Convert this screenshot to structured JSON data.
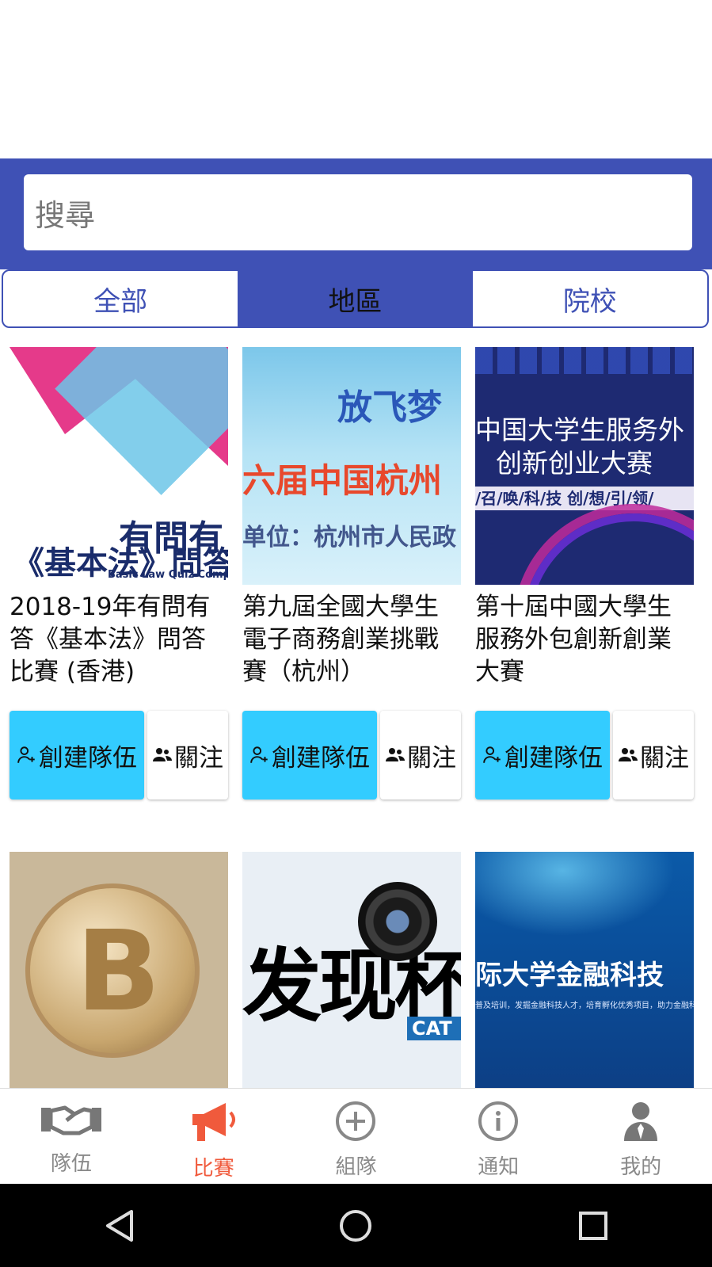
{
  "search": {
    "placeholder": "搜尋"
  },
  "tabs": [
    {
      "label": "全部",
      "active": false
    },
    {
      "label": "地區",
      "active": true
    },
    {
      "label": "院校",
      "active": false
    }
  ],
  "cards": [
    {
      "title": "2018-19年有問有答《基本法》問答比賽 (香港)",
      "image_text": [
        "有問有",
        "《基本法》問答",
        "Basic Law Quiz Compet"
      ],
      "create_label": "創建隊伍",
      "follow_label": "關注"
    },
    {
      "title": "第九屆全國大學生電子商務創業挑戰賽（杭州）",
      "image_text": [
        "放飞梦",
        "六届中国杭州",
        "单位：杭州市人民政"
      ],
      "create_label": "創建隊伍",
      "follow_label": "關注"
    },
    {
      "title": "第十屆中國大學生服務外包創新創業大賽",
      "image_text": [
        "中国大学生服务外",
        "创新创业大赛",
        "/召/唤/科/技 创/想/引/领/"
      ],
      "create_label": "創建隊伍",
      "follow_label": "關注"
    },
    {
      "title": "",
      "image_text": [
        "B"
      ]
    },
    {
      "title": "",
      "image_text": [
        "发现杯",
        "CAT"
      ]
    },
    {
      "title": "",
      "image_text": [
        "际大学金融科技",
        "普及培训，发掘金融科技人才，培育孵化优秀项目，助力金融科"
      ]
    }
  ],
  "bottom_nav": [
    {
      "label": "隊伍",
      "icon": "handshake-icon",
      "active": false
    },
    {
      "label": "比賽",
      "icon": "megaphone-icon",
      "active": true
    },
    {
      "label": "組隊",
      "icon": "plus-circle-icon",
      "active": false
    },
    {
      "label": "通知",
      "icon": "info-icon",
      "active": false
    },
    {
      "label": "我的",
      "icon": "user-icon",
      "active": false
    }
  ],
  "colors": {
    "primary": "#3f51b5",
    "create_button": "#33ccff",
    "active_nav": "#f05a3c",
    "inactive_nav": "#8a8a8a"
  }
}
